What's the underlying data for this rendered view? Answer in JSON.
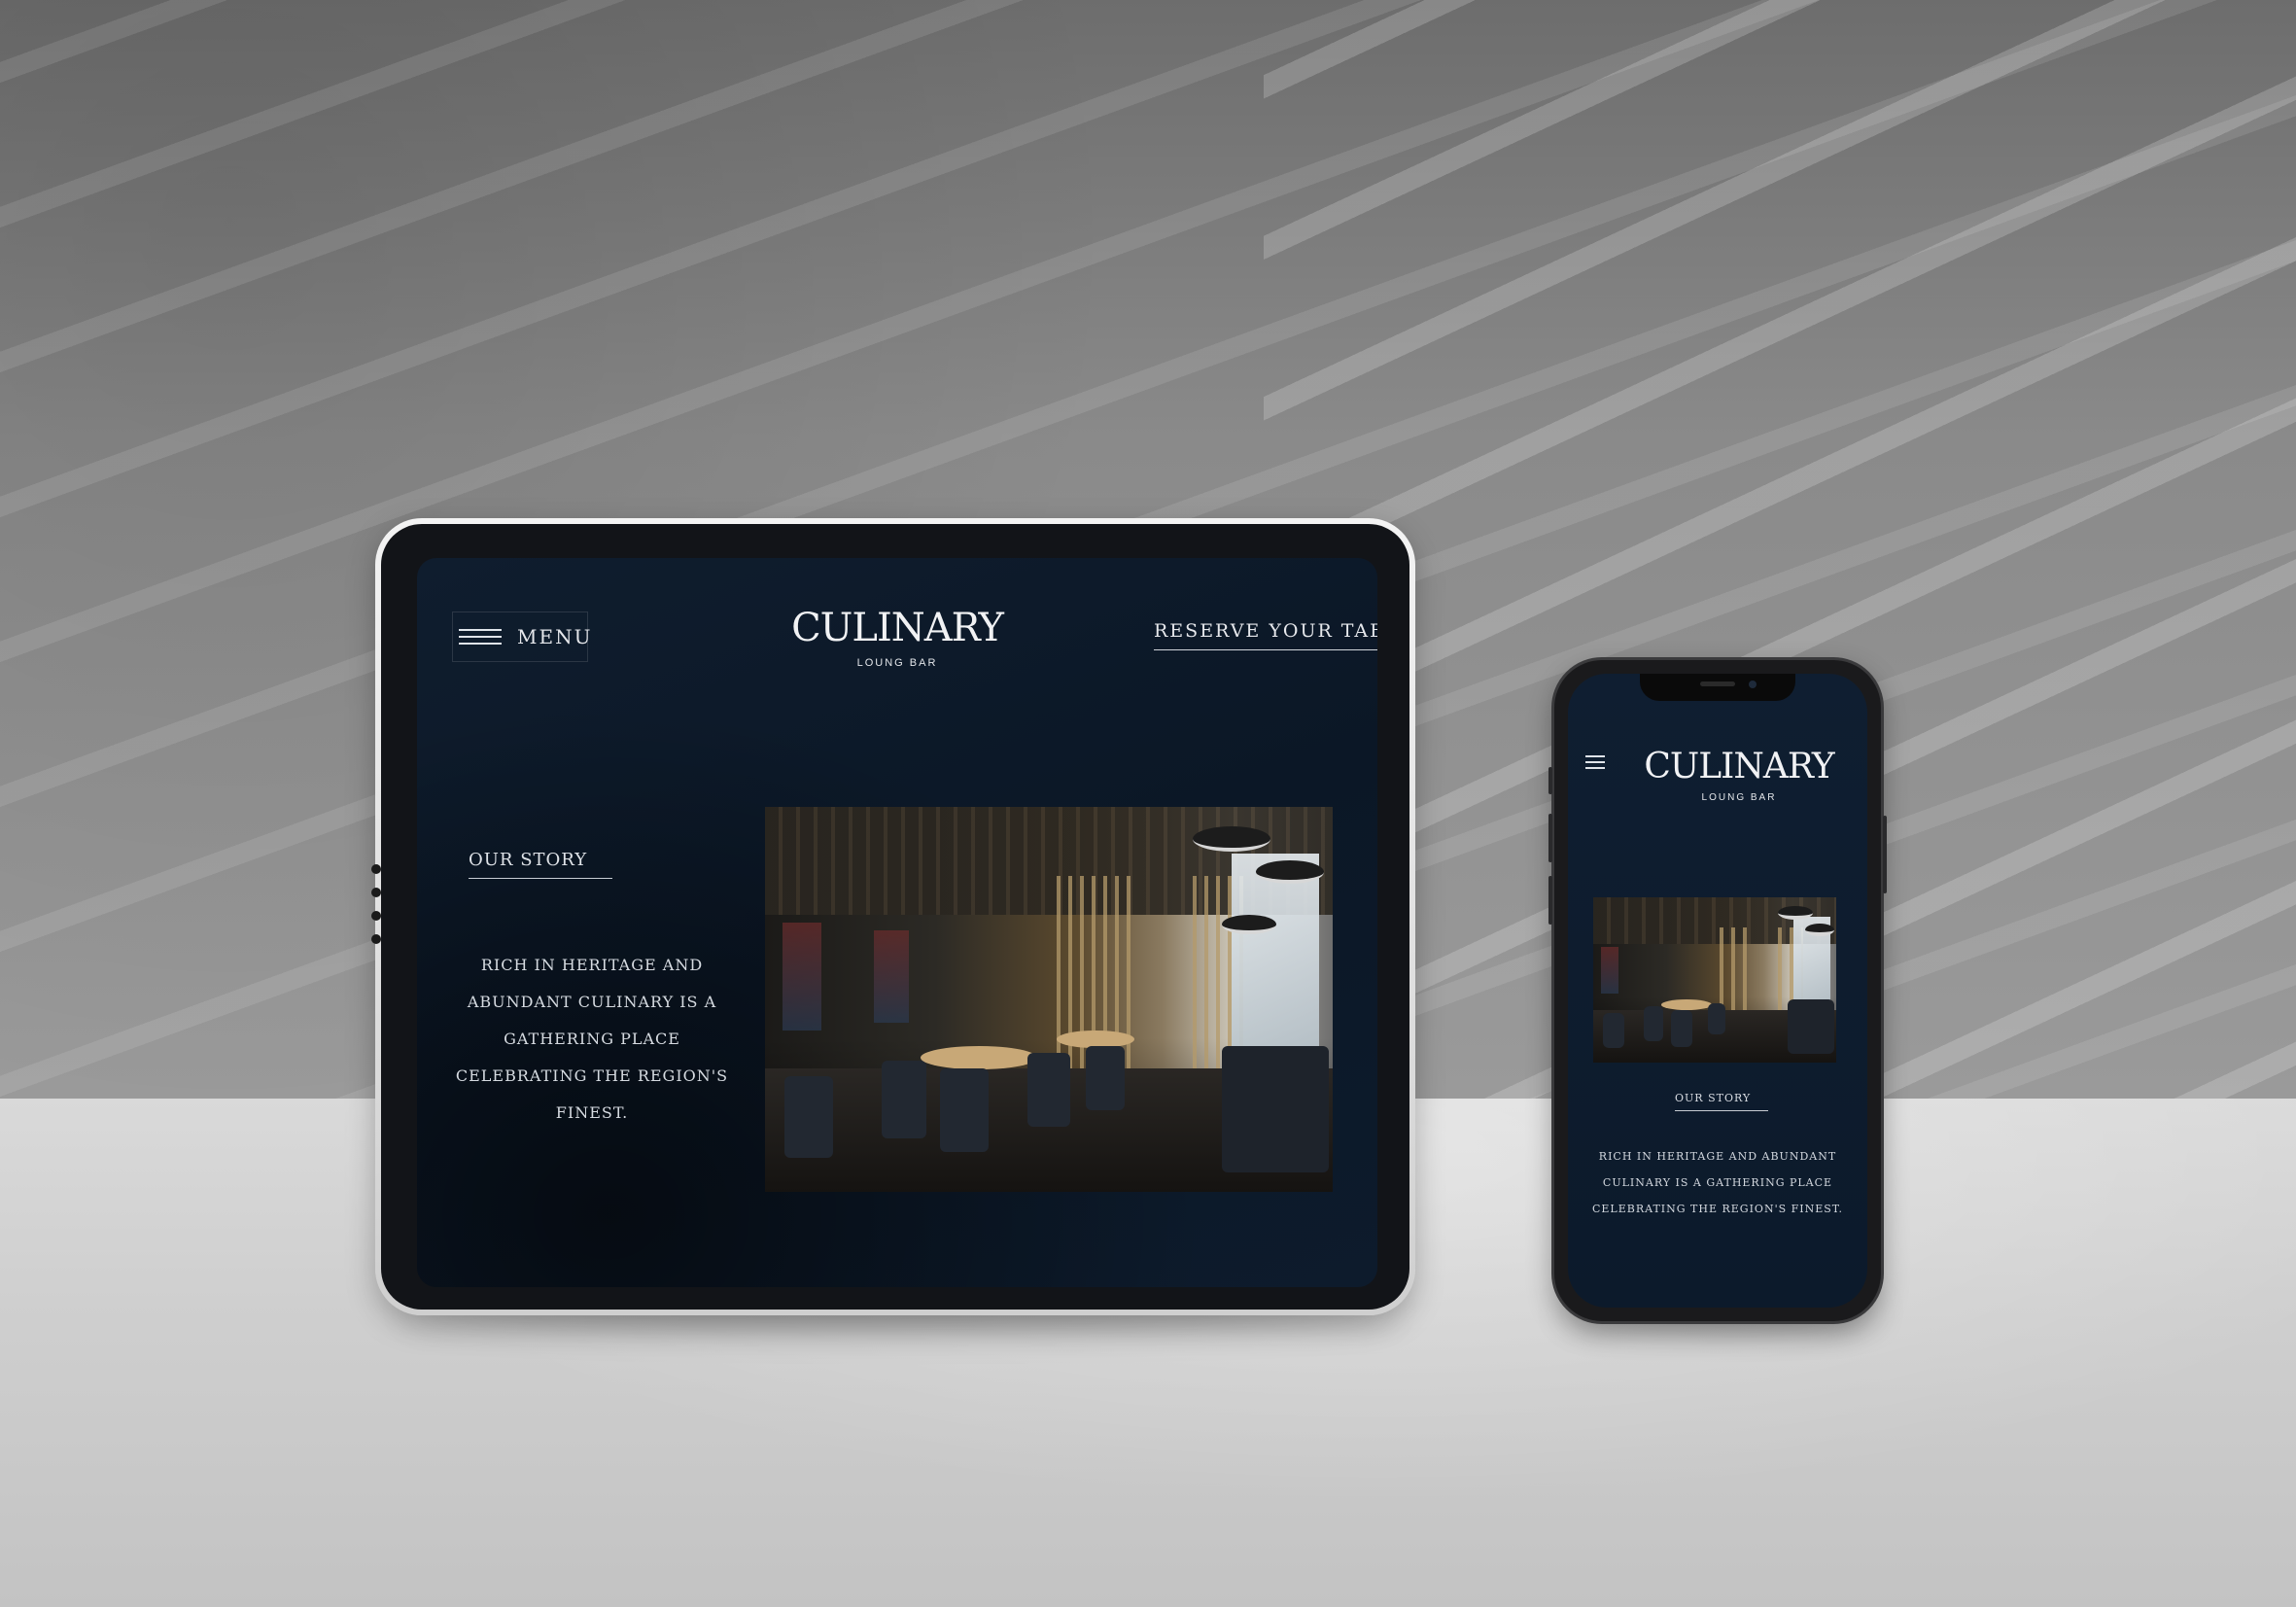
{
  "tablet": {
    "menu_label": "MENU",
    "logo_title": "CULINARY",
    "logo_subtitle": "LOUNG BAR",
    "reserve_label": "RESERVE YOUR TABLE",
    "story_heading": "OUR STORY",
    "story_body": "RICH IN HERITAGE AND ABUNDANT CULINARY IS A GATHERING PLACE CELEBRATING THE REGION'S FINEST."
  },
  "phone": {
    "logo_title": "CULINARY",
    "logo_subtitle": "LOUNG BAR",
    "story_heading": "OUR STORY",
    "story_body": "RICH IN HERITAGE AND ABUNDANT CULINARY IS A GATHERING PLACE CELEBRATING THE REGION'S FINEST."
  },
  "colors": {
    "screen_bg": "#0c1a2b",
    "text": "#e6e8ec",
    "wall": "#8a8a8a",
    "floor": "#d2d2d2"
  },
  "icons": [
    "hamburger-menu-icon",
    "camera-icon"
  ]
}
